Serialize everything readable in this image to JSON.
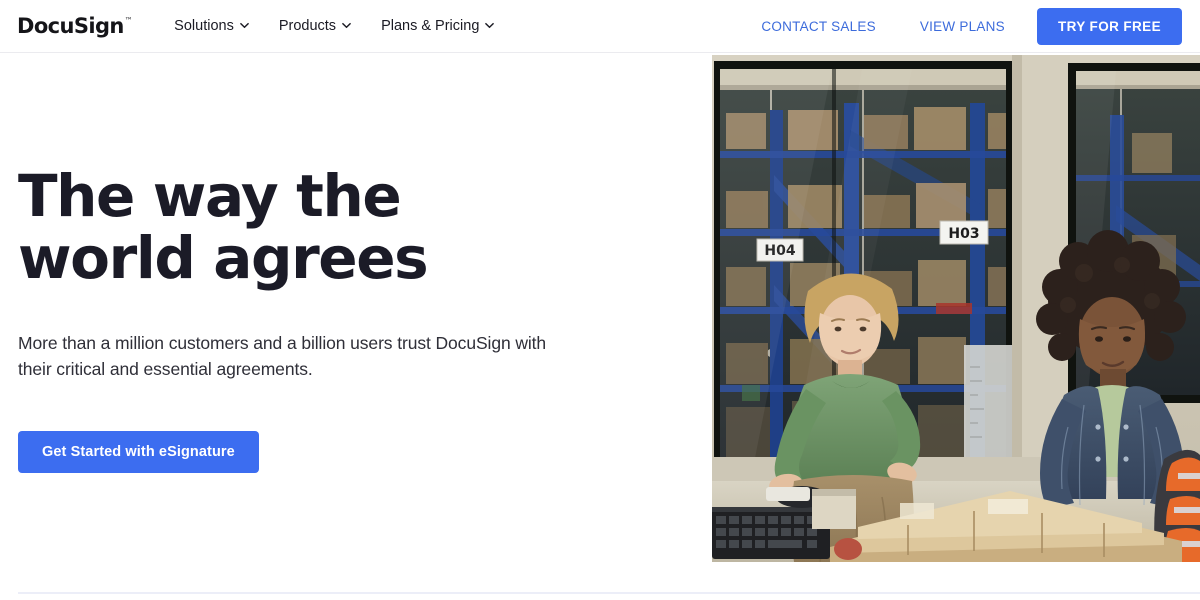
{
  "brand": {
    "name": "DocuSign",
    "trademark": "™"
  },
  "nav": {
    "links": [
      {
        "label": "Solutions",
        "icon": "chevron-down-icon"
      },
      {
        "label": "Products",
        "icon": "chevron-down-icon"
      },
      {
        "label": "Plans & Pricing",
        "icon": "chevron-down-icon"
      }
    ],
    "contact_sales": "CONTACT SALES",
    "view_plans": "VIEW PLANS",
    "try_for_free": "TRY FOR FREE"
  },
  "hero": {
    "title": "The way the world agrees",
    "subtitle": "More than a million customers and a billion users trust DocuSign with their critical and essential agreements.",
    "cta": "Get Started with eSignature",
    "image_alt": "Two warehouse workers at a counter in front of a stocked warehouse seen through windows",
    "image_labels": [
      "H04",
      "H03"
    ]
  },
  "colors": {
    "accent_blue": "#3c6df0",
    "link_blue": "#3c6bdb",
    "heading": "#1b1b27",
    "body_text": "#2f2f38",
    "nav_border": "#ebebef",
    "background": "#ffffff"
  }
}
